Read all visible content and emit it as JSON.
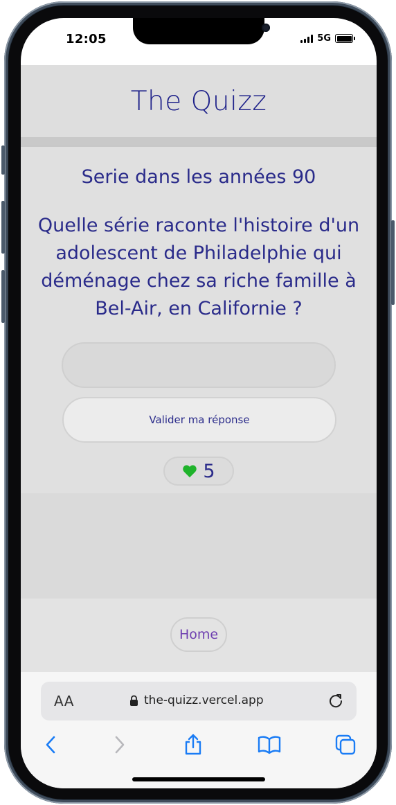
{
  "status_bar": {
    "time": "12:05",
    "network": "5G"
  },
  "app": {
    "title": "The Quizz",
    "category": "Serie dans les années 90",
    "question": "Quelle série raconte l'histoire d'un adolescent de Philadelphie qui déménage chez sa riche famille à Bel-Air, en Californie ?",
    "answer_input": {
      "value": "",
      "placeholder": ""
    },
    "submit_label": "Valider ma réponse",
    "lives": {
      "count": "5",
      "icon": "heart-icon",
      "icon_color": "#1fb32b"
    },
    "home_label": "Home"
  },
  "browser": {
    "text_size_label": "AA",
    "url": "the-quizz.vercel.app",
    "icons": [
      "lock-icon",
      "reload-icon",
      "back-icon",
      "forward-icon",
      "share-icon",
      "bookmarks-icon",
      "tabs-icon"
    ],
    "accent": "#1a7cf5"
  },
  "colors": {
    "primary_text": "#2a2b8a",
    "link_purple": "#6e3fb0",
    "background": "#dcdcdc"
  }
}
